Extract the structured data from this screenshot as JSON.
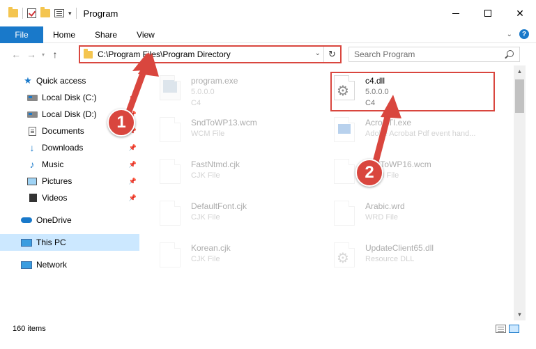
{
  "window": {
    "title": "Program",
    "controls": {
      "minimize": "minimize",
      "maximize": "maximize",
      "close": "✕"
    }
  },
  "ribbon": {
    "tabs": [
      "File",
      "Home",
      "Share",
      "View"
    ],
    "help": "?"
  },
  "address_bar": {
    "path": "C:\\Program Files\\Program Directory",
    "search_placeholder": "Search Program"
  },
  "sidebar": {
    "items": [
      {
        "label": "Quick access",
        "icon": "star-icon",
        "pinned": false
      },
      {
        "label": "Local Disk (C:)",
        "icon": "drive-icon",
        "pinned": true
      },
      {
        "label": "Local Disk (D:)",
        "icon": "drive-icon",
        "pinned": true
      },
      {
        "label": "Documents",
        "icon": "documents-icon",
        "pinned": true
      },
      {
        "label": "Downloads",
        "icon": "downloads-icon",
        "pinned": true
      },
      {
        "label": "Music",
        "icon": "music-icon",
        "pinned": true
      },
      {
        "label": "Pictures",
        "icon": "pictures-icon",
        "pinned": true
      },
      {
        "label": "Videos",
        "icon": "videos-icon",
        "pinned": true
      },
      {
        "label": "OneDrive",
        "icon": "onedrive-icon",
        "pinned": false
      },
      {
        "label": "This PC",
        "icon": "this-pc-icon",
        "pinned": false,
        "selected": true
      },
      {
        "label": "Network",
        "icon": "network-icon",
        "pinned": false
      }
    ]
  },
  "files": [
    {
      "name": "program.exe",
      "sub1": "5.0.0.0",
      "sub2": "C4",
      "icon": "exe-icon",
      "faded": true
    },
    {
      "name": "c4.dll",
      "sub1": "5.0.0.0",
      "sub2": "C4",
      "icon": "dll-gear-icon",
      "faded": false
    },
    {
      "name": "SndToWP13.wcm",
      "sub1": "WCM File",
      "icon": "file-icon",
      "faded": true
    },
    {
      "name": "AcroSTI.exe",
      "sub1": "Adobe Acrobat Pdf event hand...",
      "icon": "exe-blue-icon",
      "faded": true
    },
    {
      "name": "FastNtmd.cjk",
      "sub1": "CJK File",
      "icon": "file-icon",
      "faded": true
    },
    {
      "name": "SndToWP16.wcm",
      "sub1": "WCM File",
      "icon": "file-icon",
      "faded": true
    },
    {
      "name": "DefaultFont.cjk",
      "sub1": "CJK File",
      "icon": "file-icon",
      "faded": true
    },
    {
      "name": "Arabic.wrd",
      "sub1": "WRD File",
      "icon": "file-icon",
      "faded": true
    },
    {
      "name": "Korean.cjk",
      "sub1": "CJK File",
      "icon": "file-icon",
      "faded": true
    },
    {
      "name": "UpdateClient65.dll",
      "sub1": "Resource DLL",
      "icon": "dll-gear-icon",
      "faded": true
    }
  ],
  "status": {
    "item_count": "160 items"
  },
  "annotations": {
    "step1": "1",
    "step2": "2"
  },
  "colors": {
    "accent": "#1979ca",
    "highlight_red": "#d9463e",
    "selected_bg": "#cce8ff"
  }
}
